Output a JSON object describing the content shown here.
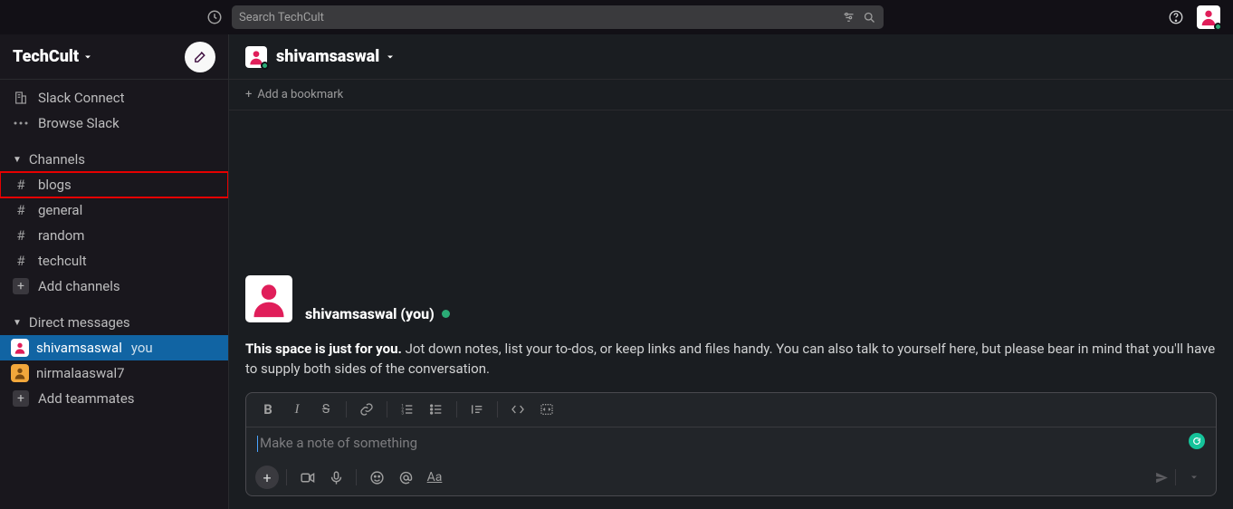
{
  "topbar": {
    "search_placeholder": "Search TechCult"
  },
  "workspace": {
    "name": "TechCult"
  },
  "sidebar": {
    "slack_connect": "Slack Connect",
    "browse_slack": "Browse Slack",
    "channels_head": "Channels",
    "channels": [
      {
        "name": "blogs",
        "highlighted": true
      },
      {
        "name": "general"
      },
      {
        "name": "random"
      },
      {
        "name": "techcult"
      }
    ],
    "add_channels": "Add channels",
    "dms_head": "Direct messages",
    "dms": [
      {
        "name": "shivamsaswal",
        "you": "you",
        "active": true,
        "avatar": "pink"
      },
      {
        "name": "nirmalaaswal7",
        "avatar": "orange"
      }
    ],
    "add_teammates": "Add teammates"
  },
  "header": {
    "title": "shivamsaswal",
    "bookmark": "Add a bookmark"
  },
  "intro": {
    "name": "shivamsaswal (you)",
    "bold": "This space is just for you.",
    "rest": " Jot down notes, list your to-dos, or keep links and files handy. You can also talk to yourself here, but please bear in mind that you'll have to supply both sides of the conversation."
  },
  "composer": {
    "placeholder": "Make a note of something"
  }
}
